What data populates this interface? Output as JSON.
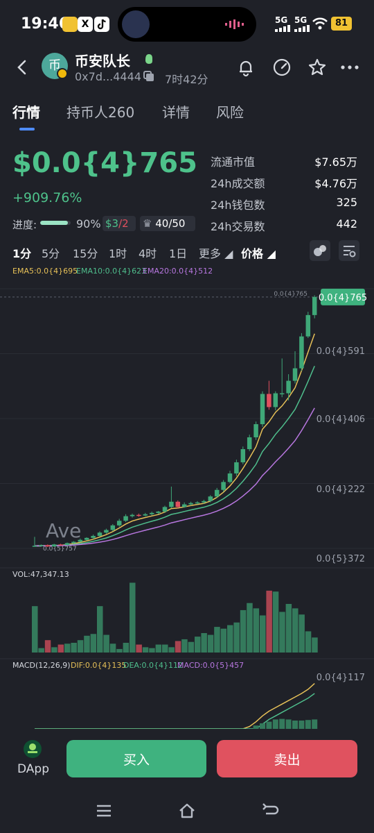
{
  "status_bar": {
    "time": "19:46",
    "signal_1": "5G",
    "signal_2": "5G",
    "battery": "81",
    "icons": [
      "wechat-green-icon",
      "x-icon",
      "tiktok-icon",
      "wifi-icon",
      "dynamic-island-media",
      "audio-wave-icon"
    ]
  },
  "header": {
    "token_name": "币安队长",
    "avatar_text": "币",
    "address": "0x7d...4444",
    "age": "7时42分",
    "icons": [
      "back-icon",
      "copy-icon",
      "bell-icon",
      "gauge-icon",
      "star-icon",
      "more-icon",
      "wave-hand-icon"
    ]
  },
  "tabs": [
    {
      "label": "行情"
    },
    {
      "label": "持币人260"
    },
    {
      "label": "详情"
    },
    {
      "label": "风险"
    }
  ],
  "price": {
    "value": "$0.0{4}765",
    "change": "+909.76%",
    "progress_label": "进度:",
    "progress_pct": "90%",
    "progress_value": 0.9,
    "pill_1_a": "3",
    "pill_1_sep": "/",
    "pill_1_b": "2",
    "pill_2": "40/50"
  },
  "stats": [
    {
      "key": "流通市值",
      "value": "$7.65万"
    },
    {
      "key": "24h成交额",
      "value": "$4.76万"
    },
    {
      "key": "24h钱包数",
      "value": "325"
    },
    {
      "key": "24h交易数",
      "value": "442"
    }
  ],
  "timeframes": [
    {
      "label": "1分"
    },
    {
      "label": "5分"
    },
    {
      "label": "15分"
    },
    {
      "label": "1时"
    },
    {
      "label": "4时"
    },
    {
      "label": "1日"
    },
    {
      "label": "更多"
    },
    {
      "label": "价格"
    }
  ],
  "ema": {
    "ema5": "EMA5:0.0{4}695",
    "ema10": "EMA10:0.0{4}623",
    "ema20": "EMA20:0.0{4}512"
  },
  "chart_labels": {
    "current_price_line": "0.0{4}765",
    "current_price_tag": "0.0{4}765",
    "y_ticks": [
      "0.0{4}591",
      "0.0{4}406",
      "0.0{4}222",
      "0.0{5}372"
    ],
    "low_marker": "0.0{5}757",
    "watermark": "Ave",
    "vol_label": "VOL:47,347.13",
    "macd_label": "MACD(12,26,9)",
    "dif": "DIF:0.0{4}135",
    "dea": "DEA:0.0{4}112",
    "macd_val": "MACD:0.0{5}457",
    "macd_tick": "0.0{4}117"
  },
  "colors": {
    "up": "#3fa878",
    "down": "#e0505e",
    "ema5": "#e7c158",
    "ema10": "#4fbf8d",
    "ema20": "#b877e0",
    "accent": "#4f8cff"
  },
  "chart_data": {
    "type": "candlestick",
    "note_units": "price in units of 1e-4",
    "candles": [
      {
        "o": 0.07,
        "c": 0.08,
        "h": 0.35,
        "l": 0.05
      },
      {
        "o": 0.08,
        "c": 0.1,
        "h": 0.12,
        "l": 0.06
      },
      {
        "o": 0.1,
        "c": 0.06,
        "h": 0.12,
        "l": 0.04
      },
      {
        "o": 0.06,
        "c": 0.12,
        "h": 0.14,
        "l": 0.05
      },
      {
        "o": 0.12,
        "c": 0.1,
        "h": 0.14,
        "l": 0.08
      },
      {
        "o": 0.1,
        "c": 0.16,
        "h": 0.18,
        "l": 0.08
      },
      {
        "o": 0.16,
        "c": 0.2,
        "h": 0.22,
        "l": 0.14
      },
      {
        "o": 0.2,
        "c": 0.26,
        "h": 0.3,
        "l": 0.18
      },
      {
        "o": 0.26,
        "c": 0.32,
        "h": 0.34,
        "l": 0.24
      },
      {
        "o": 0.32,
        "c": 0.38,
        "h": 0.42,
        "l": 0.28
      },
      {
        "o": 0.38,
        "c": 0.48,
        "h": 0.52,
        "l": 0.36
      },
      {
        "o": 0.48,
        "c": 0.56,
        "h": 0.6,
        "l": 0.44
      },
      {
        "o": 0.56,
        "c": 0.7,
        "h": 0.74,
        "l": 0.52
      },
      {
        "o": 0.7,
        "c": 0.84,
        "h": 0.9,
        "l": 0.66
      },
      {
        "o": 0.84,
        "c": 0.98,
        "h": 1.04,
        "l": 0.8
      },
      {
        "o": 0.98,
        "c": 1.02,
        "h": 1.06,
        "l": 0.94
      },
      {
        "o": 1.02,
        "c": 1.0,
        "h": 1.06,
        "l": 0.96
      },
      {
        "o": 1.0,
        "c": 1.04,
        "h": 1.08,
        "l": 0.98
      },
      {
        "o": 1.04,
        "c": 1.08,
        "h": 1.12,
        "l": 1.0
      },
      {
        "o": 1.08,
        "c": 1.12,
        "h": 1.14,
        "l": 1.04
      },
      {
        "o": 1.12,
        "c": 1.26,
        "h": 1.3,
        "l": 1.08
      },
      {
        "o": 1.26,
        "c": 1.42,
        "h": 1.88,
        "l": 1.22
      },
      {
        "o": 1.42,
        "c": 1.26,
        "h": 1.46,
        "l": 1.22
      },
      {
        "o": 1.26,
        "c": 1.34,
        "h": 1.4,
        "l": 1.24
      },
      {
        "o": 1.34,
        "c": 1.38,
        "h": 1.42,
        "l": 1.3
      },
      {
        "o": 1.38,
        "c": 1.4,
        "h": 1.44,
        "l": 1.34
      },
      {
        "o": 1.4,
        "c": 1.44,
        "h": 1.48,
        "l": 1.36
      },
      {
        "o": 1.44,
        "c": 1.58,
        "h": 1.62,
        "l": 1.4
      },
      {
        "o": 1.58,
        "c": 1.78,
        "h": 1.84,
        "l": 1.54
      },
      {
        "o": 1.78,
        "c": 2.02,
        "h": 2.08,
        "l": 1.72
      },
      {
        "o": 2.02,
        "c": 2.28,
        "h": 2.36,
        "l": 1.98
      },
      {
        "o": 2.28,
        "c": 2.62,
        "h": 2.7,
        "l": 2.2
      },
      {
        "o": 2.62,
        "c": 3.02,
        "h": 3.1,
        "l": 2.56
      },
      {
        "o": 3.02,
        "c": 3.38,
        "h": 3.46,
        "l": 2.96
      },
      {
        "o": 3.38,
        "c": 3.78,
        "h": 3.86,
        "l": 3.3
      },
      {
        "o": 3.78,
        "c": 4.7,
        "h": 4.78,
        "l": 3.7
      },
      {
        "o": 4.7,
        "c": 4.3,
        "h": 5.1,
        "l": 4.22
      },
      {
        "o": 4.3,
        "c": 4.72,
        "h": 4.78,
        "l": 4.2
      },
      {
        "o": 4.72,
        "c": 4.72,
        "h": 5.78,
        "l": 4.6
      },
      {
        "o": 4.72,
        "c": 5.1,
        "h": 5.3,
        "l": 4.5
      },
      {
        "o": 5.1,
        "c": 5.48,
        "h": 6.0,
        "l": 5.02
      },
      {
        "o": 5.48,
        "c": 6.45,
        "h": 6.55,
        "l": 5.4
      },
      {
        "o": 6.45,
        "c": 7.1,
        "h": 7.2,
        "l": 6.4
      },
      {
        "o": 7.1,
        "c": 7.65,
        "h": 7.7,
        "l": 7.0
      }
    ],
    "volume": [
      105,
      10,
      28,
      12,
      18,
      20,
      22,
      28,
      38,
      42,
      105,
      40,
      20,
      8,
      22,
      158,
      18,
      12,
      10,
      18,
      18,
      12,
      26,
      30,
      24,
      36,
      44,
      40,
      58,
      54,
      62,
      68,
      96,
      112,
      100,
      84,
      140,
      138,
      92,
      110,
      100,
      86,
      48,
      34
    ],
    "macd_dif": [
      0,
      0,
      0,
      0,
      0,
      0,
      0,
      0,
      0,
      0,
      0,
      0,
      0,
      0,
      0,
      0,
      0,
      0,
      0,
      0,
      0.02,
      0.05,
      0.06,
      0.08,
      0.1,
      0.12,
      0.15,
      0.18,
      0.22,
      0.26,
      0.3,
      0.34,
      0.38,
      0.44,
      0.52,
      0.62,
      0.7,
      0.76,
      0.82,
      0.88,
      0.94,
      1.0,
      1.07,
      1.17
    ],
    "macd_dea": [
      0,
      0,
      0,
      0,
      0,
      0,
      0,
      0,
      0,
      0,
      0,
      0,
      0,
      0,
      0,
      0,
      0,
      0,
      0,
      0,
      0,
      0,
      0,
      0,
      0.02,
      0.04,
      0.06,
      0.08,
      0.11,
      0.15,
      0.19,
      0.23,
      0.27,
      0.32,
      0.4,
      0.48,
      0.56,
      0.62,
      0.68,
      0.74,
      0.8,
      0.86,
      0.92,
      1.0
    ],
    "macd_hist": [
      0,
      0,
      0,
      0,
      0,
      0,
      0,
      0,
      0,
      0,
      0,
      0,
      0,
      0,
      0,
      0,
      0,
      0,
      0,
      0,
      0,
      0,
      0,
      0,
      0,
      0,
      0,
      0,
      0,
      0,
      0,
      0,
      0,
      0,
      0.12,
      0.2,
      0.26,
      0.34,
      0.36,
      0.34,
      0.3,
      0.3,
      0.32,
      0.34
    ],
    "ylim": [
      0.0372,
      7.9
    ]
  }
}
